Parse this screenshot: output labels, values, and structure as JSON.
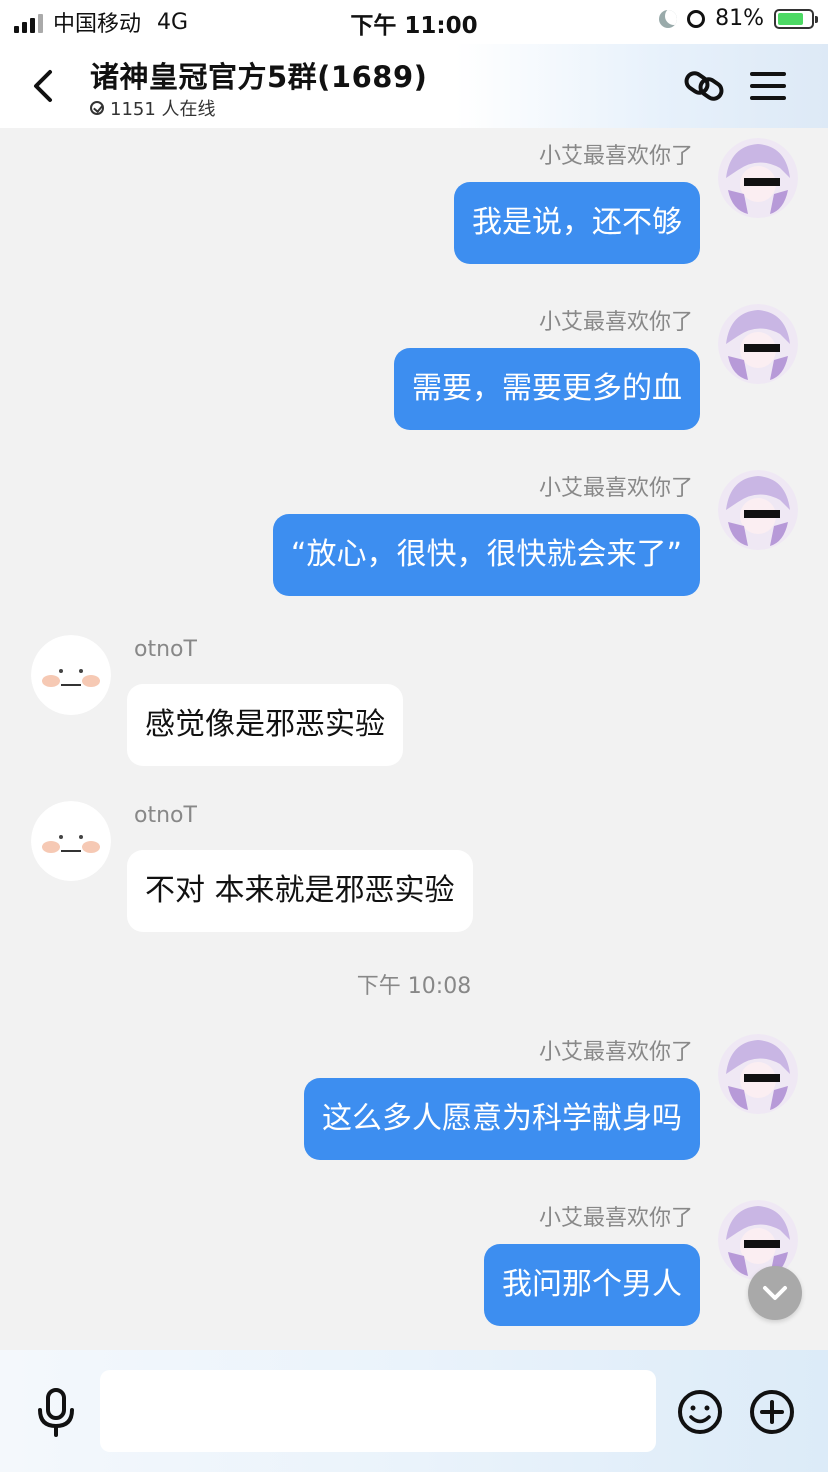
{
  "status": {
    "carrier": "中国移动",
    "network": "4G",
    "time": "下午 11:00",
    "battery": "81%"
  },
  "header": {
    "title": "诸神皇冠官方5群(1689)",
    "online": "1151 人在线"
  },
  "messages": [
    {
      "sender": "小艾最喜欢你了",
      "text": "我是说，还不够",
      "mine": true
    },
    {
      "sender": "小艾最喜欢你了",
      "text": "需要，需要更多的血",
      "mine": true
    },
    {
      "sender": "小艾最喜欢你了",
      "text": "“放心，很快，很快就会来了”",
      "mine": true
    },
    {
      "sender": "otnoT",
      "text": "感觉像是邪恶实验",
      "mine": false
    },
    {
      "sender": "otnoT",
      "text": "不对 本来就是邪恶实验",
      "mine": false
    },
    {
      "sender": "小艾最喜欢你了",
      "text": "这么多人愿意为科学献身吗",
      "mine": true
    },
    {
      "sender": "小艾最喜欢你了",
      "text": "我问那个男人",
      "mine": true
    }
  ],
  "time_separator": "下午 10:08",
  "input": {
    "value": ""
  },
  "colors": {
    "bubble_mine": "#3d8ef0",
    "bubble_other": "#ffffff",
    "background": "#f2f2f2"
  },
  "icons": [
    "back-arrow-icon",
    "link-icon",
    "menu-icon",
    "microphone-icon",
    "emoji-icon",
    "plus-icon",
    "chevron-down-icon"
  ]
}
